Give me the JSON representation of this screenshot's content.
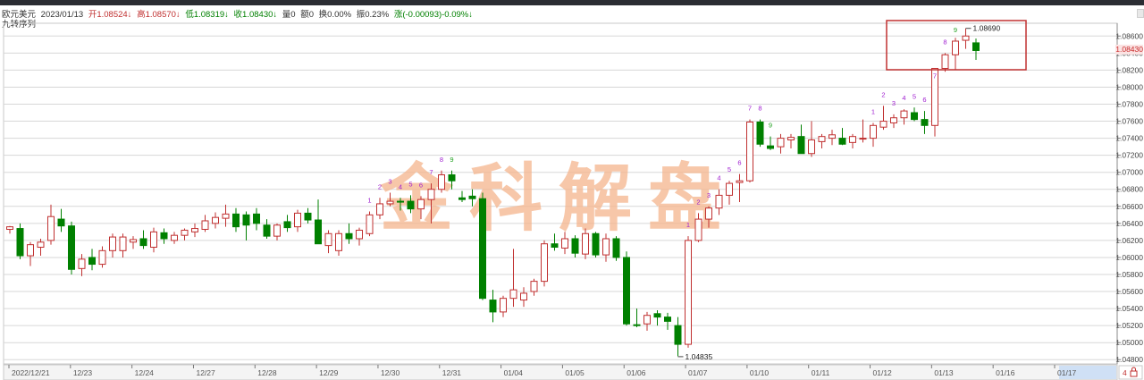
{
  "header": {
    "symbol": "欧元美元",
    "date": "2023/01/13",
    "open": "开1.08524↓",
    "high": "高1.08570↓",
    "low": "低1.08319↓",
    "close": "收1.08430↓",
    "volume": "量0",
    "amount": "额0",
    "turnover": "换0.00%",
    "amplitude": "振0.23%",
    "change": "涨(-0.00093)-0.09%↓"
  },
  "indicator_label": "九转序列",
  "current_price_tag": "1.08430",
  "watermark": "金科解盘",
  "colors": {
    "up": "#c03030",
    "down": "#008000",
    "grid": "#d7d7d7",
    "highlight_box": "#c03030",
    "current_price": "#c82828",
    "seq_label": "#a020d0",
    "seq_label_last": "#20a020"
  },
  "chart_data": {
    "type": "candlestick",
    "ylim": [
      1.0475,
      1.0875
    ],
    "y_ticks": [
      "1.08600",
      "1.08400",
      "1.08200",
      "1.08000",
      "1.07800",
      "1.07600",
      "1.07400",
      "1.07200",
      "1.07000",
      "1.06800",
      "1.06600",
      "1.06400",
      "1.06200",
      "1.06000",
      "1.05800",
      "1.05600",
      "1.05400",
      "1.05200",
      "1.05000",
      "1.04800"
    ],
    "x_labels": [
      "2022/12/21",
      "12/23",
      "12/24",
      "12/27",
      "12/28",
      "12/29",
      "12/30",
      "12/31",
      "01/04",
      "01/05",
      "01/06",
      "01/07",
      "01/10",
      "01/11",
      "01/12",
      "01/13",
      "01/16",
      "01/17"
    ],
    "annotations": [
      {
        "text": "1.08690",
        "price": 1.0869
      },
      {
        "text": "1.04835",
        "price": 1.04835
      }
    ],
    "candles": [
      {
        "o": 1.0633,
        "h": 1.0637,
        "l": 1.0628,
        "c": 1.0636
      },
      {
        "o": 1.0634,
        "h": 1.064,
        "l": 1.0598,
        "c": 1.0602
      },
      {
        "o": 1.0602,
        "h": 1.0618,
        "l": 1.059,
        "c": 1.0615
      },
      {
        "o": 1.0612,
        "h": 1.0622,
        "l": 1.0602,
        "c": 1.0618
      },
      {
        "o": 1.062,
        "h": 1.0662,
        "l": 1.0615,
        "c": 1.0648
      },
      {
        "o": 1.0645,
        "h": 1.0657,
        "l": 1.063,
        "c": 1.0637
      },
      {
        "o": 1.0637,
        "h": 1.0642,
        "l": 1.058,
        "c": 1.0586
      },
      {
        "o": 1.0587,
        "h": 1.0604,
        "l": 1.0578,
        "c": 1.0598
      },
      {
        "o": 1.06,
        "h": 1.061,
        "l": 1.0585,
        "c": 1.0592
      },
      {
        "o": 1.0592,
        "h": 1.0613,
        "l": 1.0588,
        "c": 1.0608
      },
      {
        "o": 1.0608,
        "h": 1.0628,
        "l": 1.06,
        "c": 1.0624
      },
      {
        "o": 1.0608,
        "h": 1.0628,
        "l": 1.06,
        "c": 1.0624
      },
      {
        "o": 1.0618,
        "h": 1.0625,
        "l": 1.061,
        "c": 1.0621
      },
      {
        "o": 1.0622,
        "h": 1.0632,
        "l": 1.061,
        "c": 1.0614
      },
      {
        "o": 1.0612,
        "h": 1.0635,
        "l": 1.0606,
        "c": 1.063
      },
      {
        "o": 1.0629,
        "h": 1.0634,
        "l": 1.0616,
        "c": 1.0622
      },
      {
        "o": 1.062,
        "h": 1.063,
        "l": 1.0616,
        "c": 1.0626
      },
      {
        "o": 1.0626,
        "h": 1.0634,
        "l": 1.062,
        "c": 1.0632
      },
      {
        "o": 1.063,
        "h": 1.064,
        "l": 1.0624,
        "c": 1.0634
      },
      {
        "o": 1.0633,
        "h": 1.065,
        "l": 1.063,
        "c": 1.0643
      },
      {
        "o": 1.064,
        "h": 1.0653,
        "l": 1.0634,
        "c": 1.0647
      },
      {
        "o": 1.0646,
        "h": 1.0662,
        "l": 1.0636,
        "c": 1.0651
      },
      {
        "o": 1.0651,
        "h": 1.0658,
        "l": 1.063,
        "c": 1.0636
      },
      {
        "o": 1.065,
        "h": 1.0654,
        "l": 1.062,
        "c": 1.0638
      },
      {
        "o": 1.0651,
        "h": 1.0658,
        "l": 1.0632,
        "c": 1.064
      },
      {
        "o": 1.0638,
        "h": 1.0645,
        "l": 1.0622,
        "c": 1.0625
      },
      {
        "o": 1.0625,
        "h": 1.064,
        "l": 1.062,
        "c": 1.0638
      },
      {
        "o": 1.0642,
        "h": 1.065,
        "l": 1.063,
        "c": 1.0635
      },
      {
        "o": 1.0636,
        "h": 1.0656,
        "l": 1.063,
        "c": 1.0652
      },
      {
        "o": 1.0652,
        "h": 1.0658,
        "l": 1.064,
        "c": 1.0644
      },
      {
        "o": 1.0644,
        "h": 1.0668,
        "l": 1.0632,
        "c": 1.0616
      },
      {
        "o": 1.0614,
        "h": 1.0632,
        "l": 1.0605,
        "c": 1.0628
      },
      {
        "o": 1.0608,
        "h": 1.0632,
        "l": 1.0602,
        "c": 1.0628
      },
      {
        "o": 1.0628,
        "h": 1.064,
        "l": 1.0616,
        "c": 1.0622
      },
      {
        "o": 1.0622,
        "h": 1.0635,
        "l": 1.0614,
        "c": 1.0632
      },
      {
        "o": 1.0628,
        "h": 1.0654,
        "l": 1.0625,
        "c": 1.065
      },
      {
        "o": 1.065,
        "h": 1.067,
        "l": 1.0645,
        "c": 1.0663
      },
      {
        "o": 1.0663,
        "h": 1.0676,
        "l": 1.066,
        "c": 1.0666
      },
      {
        "o": 1.0666,
        "h": 1.067,
        "l": 1.0655,
        "c": 1.0665
      },
      {
        "o": 1.0666,
        "h": 1.0673,
        "l": 1.0652,
        "c": 1.0657
      },
      {
        "o": 1.0657,
        "h": 1.0672,
        "l": 1.0645,
        "c": 1.0668
      },
      {
        "o": 1.0668,
        "h": 1.0687,
        "l": 1.064,
        "c": 1.068
      },
      {
        "o": 1.068,
        "h": 1.0702,
        "l": 1.0676,
        "c": 1.0697
      },
      {
        "o": 1.0697,
        "h": 1.0702,
        "l": 1.068,
        "c": 1.069
      },
      {
        "o": 1.067,
        "h": 1.0678,
        "l": 1.0665,
        "c": 1.0668
      },
      {
        "o": 1.0672,
        "h": 1.068,
        "l": 1.066,
        "c": 1.0669
      },
      {
        "o": 1.0669,
        "h": 1.0676,
        "l": 1.055,
        "c": 1.0552
      },
      {
        "o": 1.055,
        "h": 1.0562,
        "l": 1.0524,
        "c": 1.0536
      },
      {
        "o": 1.0536,
        "h": 1.0555,
        "l": 1.053,
        "c": 1.0552
      },
      {
        "o": 1.0552,
        "h": 1.061,
        "l": 1.0542,
        "c": 1.0562
      },
      {
        "o": 1.055,
        "h": 1.0565,
        "l": 1.0542,
        "c": 1.0558
      },
      {
        "o": 1.056,
        "h": 1.0575,
        "l": 1.0555,
        "c": 1.0572
      },
      {
        "o": 1.0572,
        "h": 1.062,
        "l": 1.0566,
        "c": 1.0616
      },
      {
        "o": 1.0616,
        "h": 1.0628,
        "l": 1.0608,
        "c": 1.0612
      },
      {
        "o": 1.0611,
        "h": 1.063,
        "l": 1.0604,
        "c": 1.0622
      },
      {
        "o": 1.0622,
        "h": 1.0626,
        "l": 1.06,
        "c": 1.0605
      },
      {
        "o": 1.0604,
        "h": 1.0634,
        "l": 1.0598,
        "c": 1.0628
      },
      {
        "o": 1.0628,
        "h": 1.063,
        "l": 1.06,
        "c": 1.0603
      },
      {
        "o": 1.0603,
        "h": 1.0628,
        "l": 1.0595,
        "c": 1.0622
      },
      {
        "o": 1.0622,
        "h": 1.0625,
        "l": 1.0596,
        "c": 1.06
      },
      {
        "o": 1.06,
        "h": 1.0607,
        "l": 1.052,
        "c": 1.0522
      },
      {
        "o": 1.0521,
        "h": 1.054,
        "l": 1.0518,
        "c": 1.052
      },
      {
        "o": 1.0522,
        "h": 1.0536,
        "l": 1.0514,
        "c": 1.0532
      },
      {
        "o": 1.0534,
        "h": 1.0538,
        "l": 1.052,
        "c": 1.053
      },
      {
        "o": 1.053,
        "h": 1.0535,
        "l": 1.0515,
        "c": 1.0525
      },
      {
        "o": 1.052,
        "h": 1.053,
        "l": 1.0484,
        "c": 1.0498
      },
      {
        "o": 1.0498,
        "h": 1.0625,
        "l": 1.0494,
        "c": 1.062
      },
      {
        "o": 1.062,
        "h": 1.0652,
        "l": 1.0618,
        "c": 1.0645
      },
      {
        "o": 1.0645,
        "h": 1.066,
        "l": 1.0635,
        "c": 1.0658
      },
      {
        "o": 1.0658,
        "h": 1.068,
        "l": 1.065,
        "c": 1.0673
      },
      {
        "o": 1.0673,
        "h": 1.069,
        "l": 1.0662,
        "c": 1.0687
      },
      {
        "o": 1.0688,
        "h": 1.0698,
        "l": 1.0665,
        "c": 1.069
      },
      {
        "o": 1.069,
        "h": 1.0762,
        "l": 1.0688,
        "c": 1.0759
      },
      {
        "o": 1.0759,
        "h": 1.0762,
        "l": 1.073,
        "c": 1.0733
      },
      {
        "o": 1.0731,
        "h": 1.0742,
        "l": 1.0726,
        "c": 1.0728
      },
      {
        "o": 1.073,
        "h": 1.0745,
        "l": 1.0722,
        "c": 1.074
      },
      {
        "o": 1.0738,
        "h": 1.0745,
        "l": 1.0728,
        "c": 1.0741
      },
      {
        "o": 1.0742,
        "h": 1.0756,
        "l": 1.0724,
        "c": 1.0722
      },
      {
        "o": 1.0722,
        "h": 1.076,
        "l": 1.0718,
        "c": 1.0738
      },
      {
        "o": 1.0736,
        "h": 1.0745,
        "l": 1.0728,
        "c": 1.0742
      },
      {
        "o": 1.074,
        "h": 1.075,
        "l": 1.0732,
        "c": 1.0744
      },
      {
        "o": 1.074,
        "h": 1.0752,
        "l": 1.0732,
        "c": 1.0733
      },
      {
        "o": 1.0735,
        "h": 1.0745,
        "l": 1.0728,
        "c": 1.0742
      },
      {
        "o": 1.074,
        "h": 1.0762,
        "l": 1.0735,
        "c": 1.074
      },
      {
        "o": 1.074,
        "h": 1.0758,
        "l": 1.073,
        "c": 1.0755
      },
      {
        "o": 1.0753,
        "h": 1.0778,
        "l": 1.075,
        "c": 1.076
      },
      {
        "o": 1.0758,
        "h": 1.0768,
        "l": 1.0752,
        "c": 1.0764
      },
      {
        "o": 1.0764,
        "h": 1.0774,
        "l": 1.0756,
        "c": 1.0772
      },
      {
        "o": 1.077,
        "h": 1.0776,
        "l": 1.076,
        "c": 1.0762
      },
      {
        "o": 1.0762,
        "h": 1.0772,
        "l": 1.0745,
        "c": 1.0755
      },
      {
        "o": 1.0755,
        "h": 1.08,
        "l": 1.0742,
        "c": 1.0822
      },
      {
        "o": 1.0822,
        "h": 1.084,
        "l": 1.0818,
        "c": 1.0838
      },
      {
        "o": 1.0838,
        "h": 1.0858,
        "l": 1.082,
        "c": 1.0854
      },
      {
        "o": 1.0855,
        "h": 1.0869,
        "l": 1.0845,
        "c": 1.086
      },
      {
        "o": 1.0852,
        "h": 1.0857,
        "l": 1.0832,
        "c": 1.0843
      }
    ],
    "sequence_markers": [
      {
        "label": "1",
        "i": 35
      },
      {
        "label": "2",
        "i": 36
      },
      {
        "label": "3",
        "i": 37
      },
      {
        "label": "4",
        "i": 38
      },
      {
        "label": "5",
        "i": 39
      },
      {
        "label": "6",
        "i": 40
      },
      {
        "label": "7",
        "i": 41
      },
      {
        "label": "8",
        "i": 42
      },
      {
        "label": "9",
        "i": 43
      },
      {
        "label": "1",
        "i": 66
      },
      {
        "label": "2",
        "i": 67
      },
      {
        "label": "3",
        "i": 68
      },
      {
        "label": "4",
        "i": 69
      },
      {
        "label": "5",
        "i": 70
      },
      {
        "label": "6",
        "i": 71
      },
      {
        "label": "7",
        "i": 72
      },
      {
        "label": "8",
        "i": 73
      },
      {
        "label": "9",
        "i": 74
      },
      {
        "label": "1",
        "i": 84
      },
      {
        "label": "2",
        "i": 85
      },
      {
        "label": "3",
        "i": 86
      },
      {
        "label": "4",
        "i": 87
      },
      {
        "label": "5",
        "i": 88
      },
      {
        "label": "6",
        "i": 89
      },
      {
        "label": "7",
        "i": 90
      },
      {
        "label": "8",
        "i": 91
      },
      {
        "label": "9",
        "i": 92
      }
    ]
  },
  "bottom_tab": "4",
  "bottom_tab_icon": "lock-icon"
}
